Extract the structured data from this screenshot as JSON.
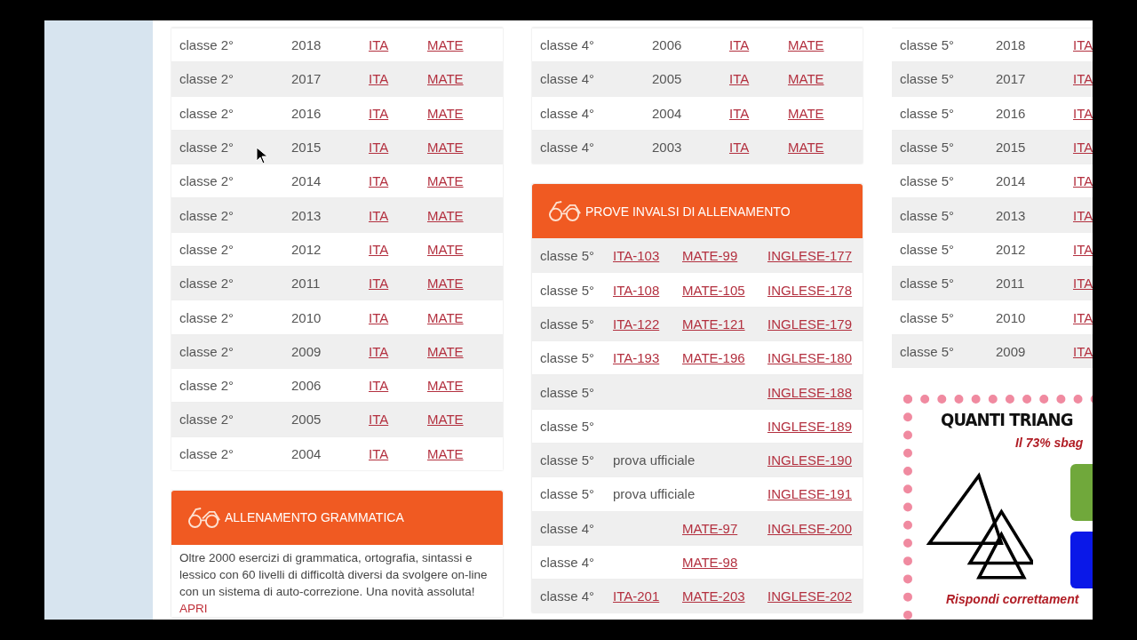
{
  "columns": [
    {
      "table": {
        "rows": [
          {
            "classe": "classe 2°",
            "year": "2018",
            "links": [
              "ITA",
              "MATE"
            ]
          },
          {
            "classe": "classe 2°",
            "year": "2017",
            "links": [
              "ITA",
              "MATE"
            ]
          },
          {
            "classe": "classe 2°",
            "year": "2016",
            "links": [
              "ITA",
              "MATE"
            ]
          },
          {
            "classe": "classe 2°",
            "year": "2015",
            "links": [
              "ITA",
              "MATE"
            ]
          },
          {
            "classe": "classe 2°",
            "year": "2014",
            "links": [
              "ITA",
              "MATE"
            ]
          },
          {
            "classe": "classe 2°",
            "year": "2013",
            "links": [
              "ITA",
              "MATE"
            ]
          },
          {
            "classe": "classe 2°",
            "year": "2012",
            "links": [
              "ITA",
              "MATE"
            ]
          },
          {
            "classe": "classe 2°",
            "year": "2011",
            "links": [
              "ITA",
              "MATE"
            ]
          },
          {
            "classe": "classe 2°",
            "year": "2010",
            "links": [
              "ITA",
              "MATE"
            ]
          },
          {
            "classe": "classe 2°",
            "year": "2009",
            "links": [
              "ITA",
              "MATE"
            ]
          },
          {
            "classe": "classe 2°",
            "year": "2006",
            "links": [
              "ITA",
              "MATE"
            ]
          },
          {
            "classe": "classe 2°",
            "year": "2005",
            "links": [
              "ITA",
              "MATE"
            ]
          },
          {
            "classe": "classe 2°",
            "year": "2004",
            "links": [
              "ITA",
              "MATE"
            ]
          }
        ]
      },
      "card": {
        "title": "ALLENAMENTO GRAMMATICA",
        "text": "Oltre 2000 esercizi di grammatica, ortografia, sintassi e lessico con 60 livelli di difficoltà diversi da svolgere on-line con un sistema di auto-correzione. Una novità assoluta!",
        "link": "APRI"
      }
    },
    {
      "table": {
        "rows": [
          {
            "classe": "classe 4°",
            "year": "2006",
            "links": [
              "ITA",
              "MATE"
            ]
          },
          {
            "classe": "classe 4°",
            "year": "2005",
            "links": [
              "ITA",
              "MATE"
            ]
          },
          {
            "classe": "classe 4°",
            "year": "2004",
            "links": [
              "ITA",
              "MATE"
            ]
          },
          {
            "classe": "classe 4°",
            "year": "2003",
            "links": [
              "ITA",
              "MATE"
            ]
          }
        ]
      },
      "card": {
        "title": "PROVE INVALSI DI ALLENAMENTO",
        "rows": [
          {
            "classe": "classe 5°",
            "ita": "ITA-103",
            "mate": "MATE-99",
            "inglese": "INGLESE-177"
          },
          {
            "classe": "classe 5°",
            "ita": "ITA-108",
            "mate": "MATE-105",
            "inglese": "INGLESE-178"
          },
          {
            "classe": "classe 5°",
            "ita": "ITA-122",
            "mate": "MATE-121",
            "inglese": "INGLESE-179"
          },
          {
            "classe": "classe 5°",
            "ita": "ITA-193",
            "mate": "MATE-196",
            "inglese": "INGLESE-180"
          },
          {
            "classe": "classe 5°",
            "inglese": "INGLESE-188"
          },
          {
            "classe": "classe 5°",
            "inglese": "INGLESE-189"
          },
          {
            "classe": "classe 5°",
            "note": "prova ufficiale",
            "inglese": "INGLESE-190"
          },
          {
            "classe": "classe 5°",
            "note": "prova ufficiale",
            "inglese": "INGLESE-191"
          },
          {
            "classe": "classe 4°",
            "mate": "MATE-97",
            "inglese": "INGLESE-200"
          },
          {
            "classe": "classe 4°",
            "mate": "MATE-98"
          },
          {
            "classe": "classe 4°",
            "ita": "ITA-201",
            "mate": "MATE-203",
            "inglese": "INGLESE-202"
          }
        ]
      }
    },
    {
      "table": {
        "rows": [
          {
            "classe": "classe 5°",
            "year": "2018",
            "links": [
              "ITA"
            ]
          },
          {
            "classe": "classe 5°",
            "year": "2017",
            "links": [
              "ITA"
            ]
          },
          {
            "classe": "classe 5°",
            "year": "2016",
            "links": [
              "ITA"
            ]
          },
          {
            "classe": "classe 5°",
            "year": "2015",
            "links": [
              "ITA"
            ]
          },
          {
            "classe": "classe 5°",
            "year": "2014",
            "links": [
              "ITA"
            ]
          },
          {
            "classe": "classe 5°",
            "year": "2013",
            "links": [
              "ITA"
            ]
          },
          {
            "classe": "classe 5°",
            "year": "2012",
            "links": [
              "ITA"
            ]
          },
          {
            "classe": "classe 5°",
            "year": "2011",
            "links": [
              "ITA"
            ]
          },
          {
            "classe": "classe 5°",
            "year": "2010",
            "links": [
              "ITA"
            ]
          },
          {
            "classe": "classe 5°",
            "year": "2009",
            "links": [
              "ITA"
            ]
          }
        ]
      },
      "ad": {
        "headline": "QUANTI TRIANG",
        "subline": "Il 73% sbag",
        "footer": "Rispondi correttament"
      }
    }
  ]
}
